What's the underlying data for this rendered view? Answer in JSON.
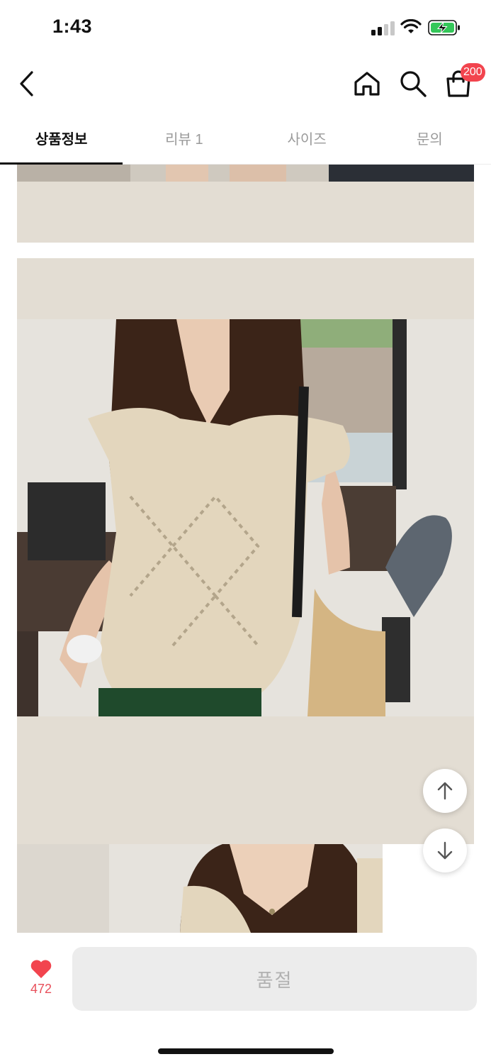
{
  "status_bar": {
    "time": "1:43"
  },
  "nav": {
    "back_icon": "chevron-left-icon",
    "home_icon": "home-icon",
    "search_icon": "search-icon",
    "cart_icon": "shopping-bag-icon",
    "cart_badge": "200"
  },
  "tabs": [
    {
      "label": "상품정보",
      "active": true
    },
    {
      "label": "리뷰 1",
      "active": false
    },
    {
      "label": "사이즈",
      "active": false
    },
    {
      "label": "문의",
      "active": false
    }
  ],
  "content": {
    "panel_color": "#e3ddd3",
    "photo_description_icon": "product-photo"
  },
  "floating": {
    "up_icon": "arrow-up-icon",
    "down_icon": "arrow-down-icon"
  },
  "bottom": {
    "wish_icon": "heart-icon",
    "wish_count": "472",
    "soldout_label": "품절"
  },
  "colors": {
    "accent": "#f2444e",
    "heart": "#f2444e",
    "active_tab": "#111111"
  }
}
